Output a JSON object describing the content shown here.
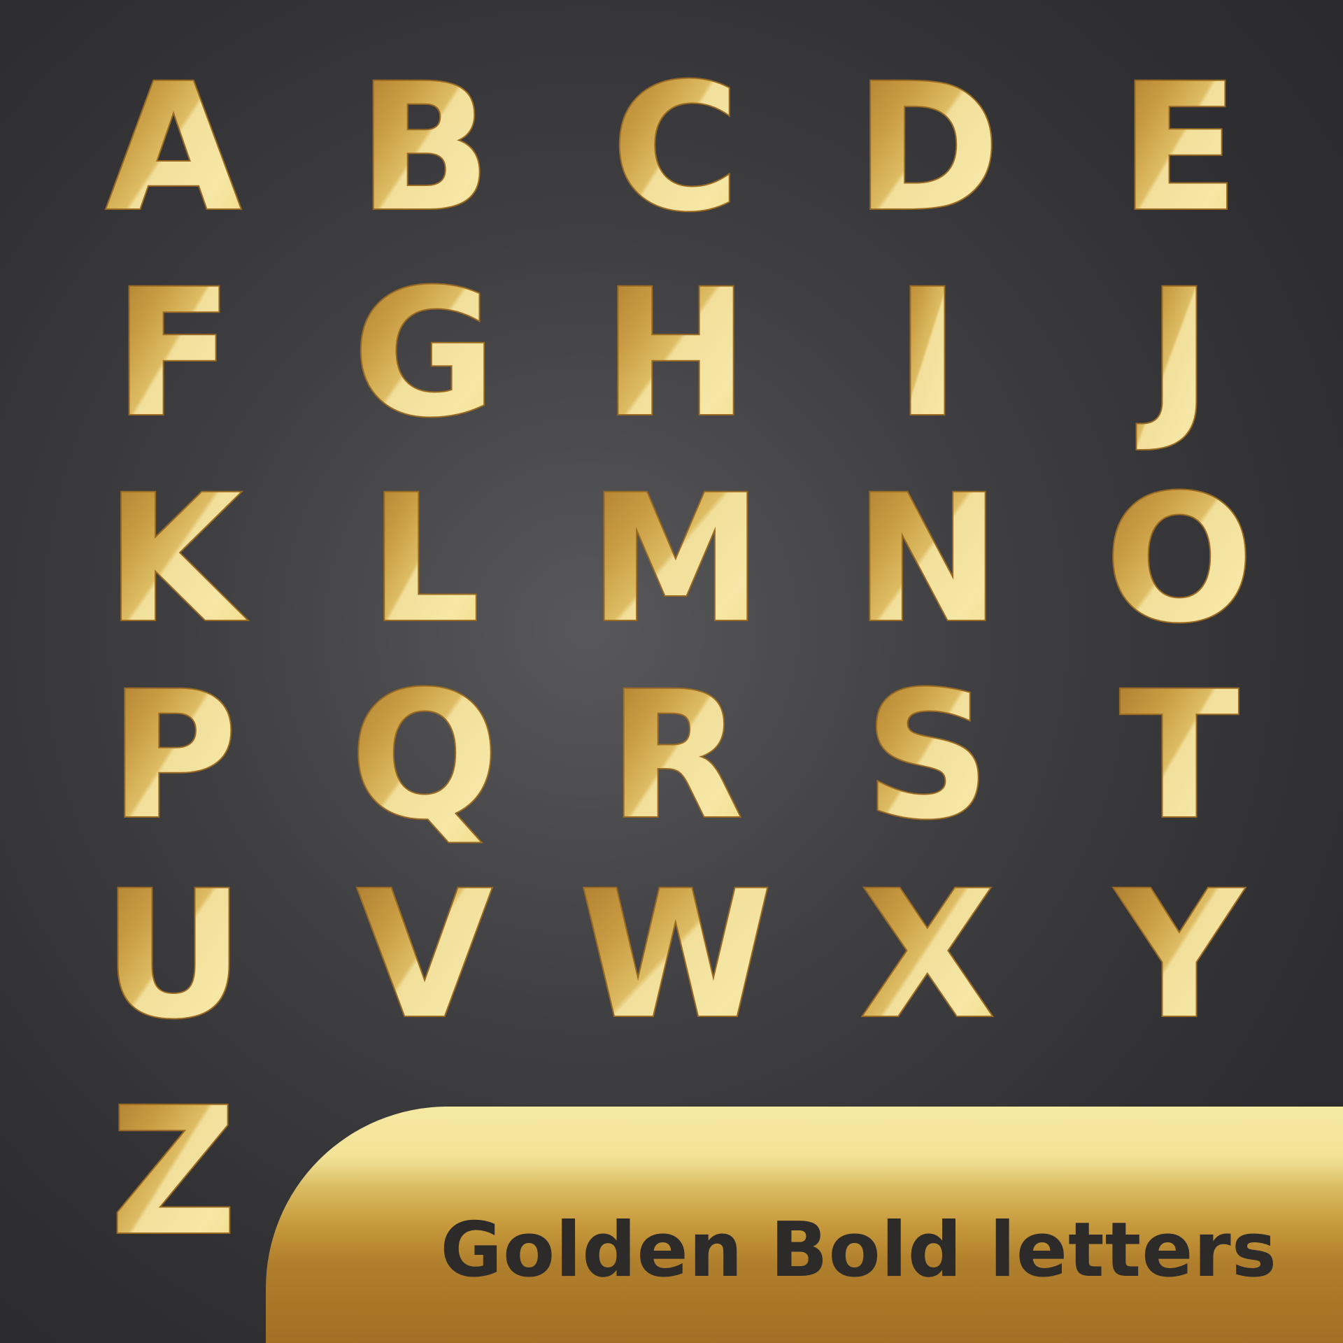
{
  "alphabet": {
    "letters": [
      "A",
      "B",
      "C",
      "D",
      "E",
      "F",
      "G",
      "H",
      "I",
      "J",
      "K",
      "L",
      "M",
      "N",
      "O",
      "P",
      "Q",
      "R",
      "S",
      "T",
      "U",
      "V",
      "W",
      "X",
      "Y",
      "Z"
    ]
  },
  "banner": {
    "title": "Golden Bold letters"
  },
  "colors": {
    "background_dark": "#2b2b2e",
    "background_center": "#58585a",
    "gold_light": "#f5e6a3",
    "gold_mid": "#d9b65a",
    "gold_dark": "#a06b22",
    "outline": "#9a6a22",
    "title_text": "#2d2b2a"
  }
}
